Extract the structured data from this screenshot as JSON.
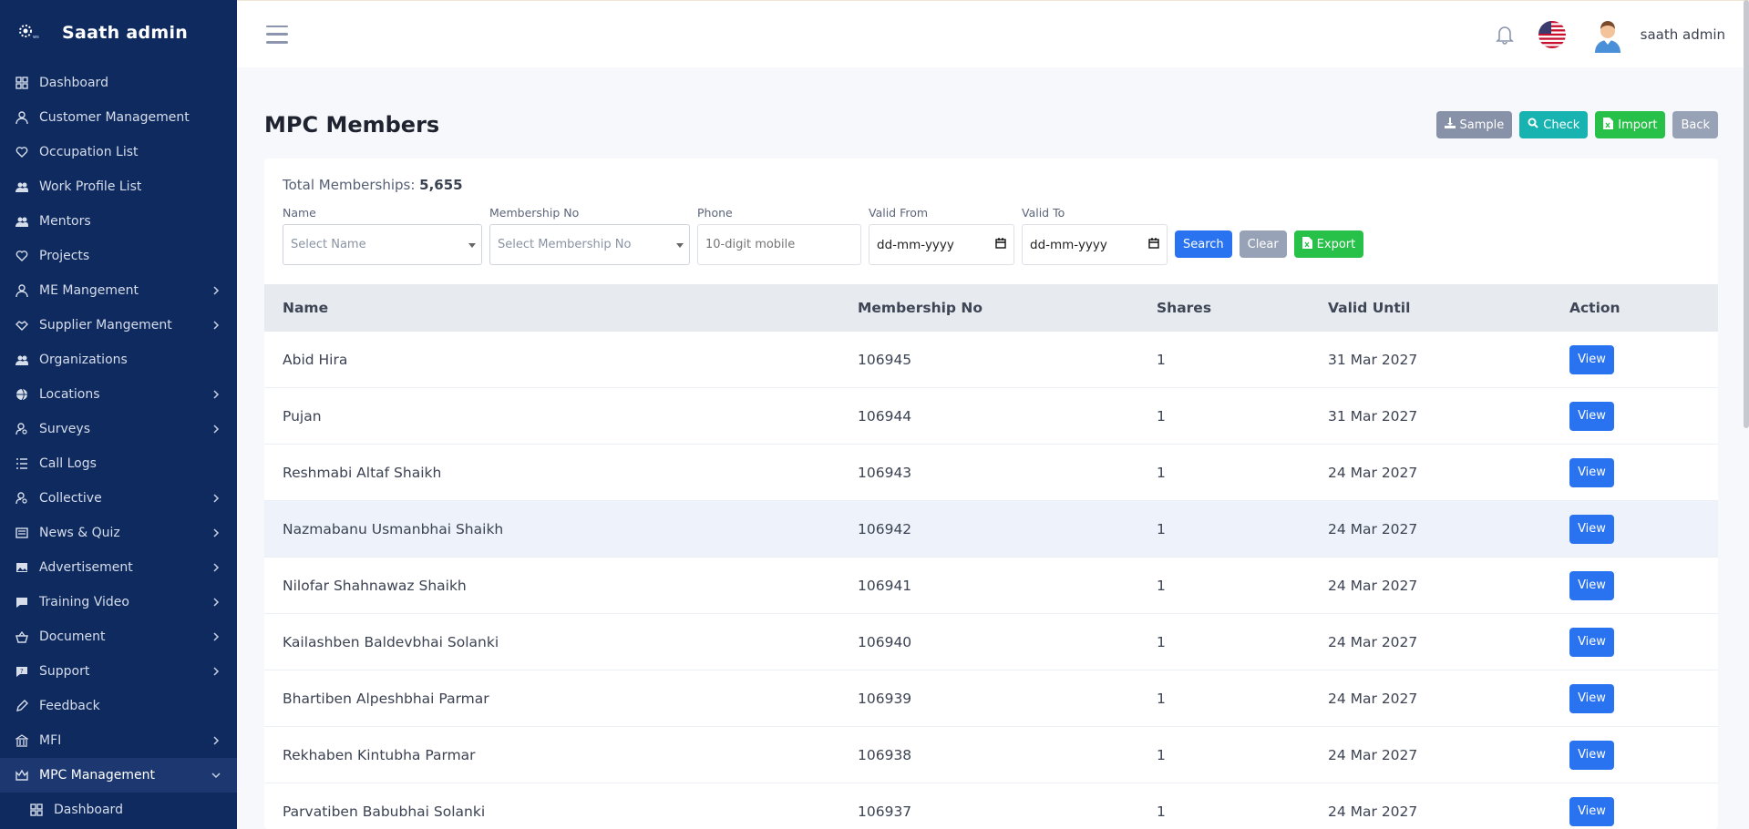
{
  "brand": {
    "title": "Saath admin"
  },
  "sidebar": {
    "items": [
      {
        "label": "Dashboard",
        "icon": "dashboard-icon",
        "chevron": false
      },
      {
        "label": "Customer Management",
        "icon": "user-icon",
        "chevron": false
      },
      {
        "label": "Occupation List",
        "icon": "heart-hand-icon",
        "chevron": false
      },
      {
        "label": "Work Profile List",
        "icon": "users-icon",
        "chevron": false
      },
      {
        "label": "Mentors",
        "icon": "users-icon",
        "chevron": false
      },
      {
        "label": "Projects",
        "icon": "heart-hand-icon",
        "chevron": false
      },
      {
        "label": "ME Mangement",
        "icon": "user-icon",
        "chevron": true
      },
      {
        "label": "Supplier Mangement",
        "icon": "handshake-icon",
        "chevron": true
      },
      {
        "label": "Organizations",
        "icon": "users-icon",
        "chevron": false
      },
      {
        "label": "Locations",
        "icon": "globe-icon",
        "chevron": true
      },
      {
        "label": "Surveys",
        "icon": "user-search-icon",
        "chevron": true
      },
      {
        "label": "Call Logs",
        "icon": "list-icon",
        "chevron": false
      },
      {
        "label": "Collective",
        "icon": "user-search-icon",
        "chevron": true
      },
      {
        "label": "News & Quiz",
        "icon": "newspaper-icon",
        "chevron": true
      },
      {
        "label": "Advertisement",
        "icon": "image-icon",
        "chevron": true
      },
      {
        "label": "Training Video",
        "icon": "chat-icon",
        "chevron": true
      },
      {
        "label": "Document",
        "icon": "basket-icon",
        "chevron": true
      },
      {
        "label": "Support",
        "icon": "support-icon",
        "chevron": true
      },
      {
        "label": "Feedback",
        "icon": "pen-icon",
        "chevron": false
      },
      {
        "label": "MFI",
        "icon": "bank-icon",
        "chevron": true
      },
      {
        "label": "MPC Management",
        "icon": "crown-icon",
        "chevron": true,
        "active": true,
        "expanded": true
      },
      {
        "label": "Dashboard",
        "icon": "dashboard-icon",
        "chevron": false,
        "sub": true
      }
    ]
  },
  "topbar": {
    "username": "saath admin"
  },
  "page": {
    "title": "MPC Members",
    "buttons": {
      "sample": "Sample",
      "check": "Check",
      "import": "Import",
      "back": "Back"
    }
  },
  "summary": {
    "label": "Total Memberships:",
    "value": "5,655"
  },
  "filters": {
    "name_label": "Name",
    "name_placeholder": "Select Name",
    "mno_label": "Membership No",
    "mno_placeholder": "Select Membership No",
    "phone_label": "Phone",
    "phone_placeholder": "10-digit mobile",
    "from_label": "Valid From",
    "from_value": "dd-mm-yyyy",
    "to_label": "Valid To",
    "to_value": "dd-mm-yyyy",
    "search": "Search",
    "clear": "Clear",
    "export": "Export"
  },
  "table": {
    "headers": {
      "name": "Name",
      "mno": "Membership No",
      "shares": "Shares",
      "valid": "Valid Until",
      "action": "Action"
    },
    "rows": [
      {
        "name": "Abid Hira",
        "mno": "106945",
        "shares": "1",
        "valid": "31 Mar 2027",
        "action": "View"
      },
      {
        "name": "Pujan",
        "mno": "106944",
        "shares": "1",
        "valid": "31 Mar 2027",
        "action": "View"
      },
      {
        "name": "Reshmabi Altaf Shaikh",
        "mno": "106943",
        "shares": "1",
        "valid": "24 Mar 2027",
        "action": "View"
      },
      {
        "name": "Nazmabanu Usmanbhai Shaikh",
        "mno": "106942",
        "shares": "1",
        "valid": "24 Mar 2027",
        "action": "View",
        "highlight": true
      },
      {
        "name": "Nilofar Shahnawaz Shaikh",
        "mno": "106941",
        "shares": "1",
        "valid": "24 Mar 2027",
        "action": "View"
      },
      {
        "name": "Kailashben Baldevbhai Solanki",
        "mno": "106940",
        "shares": "1",
        "valid": "24 Mar 2027",
        "action": "View"
      },
      {
        "name": "Bhartiben Alpeshbhai Parmar",
        "mno": "106939",
        "shares": "1",
        "valid": "24 Mar 2027",
        "action": "View"
      },
      {
        "name": "Rekhaben Kintubha Parmar",
        "mno": "106938",
        "shares": "1",
        "valid": "24 Mar 2027",
        "action": "View"
      },
      {
        "name": "Parvatiben Babubhai Solanki",
        "mno": "106937",
        "shares": "1",
        "valid": "24 Mar 2027",
        "action": "View"
      }
    ]
  },
  "colors": {
    "sidebar_bg": "#0f2a5f",
    "primary": "#2a73f0",
    "teal": "#16b3b1",
    "green": "#27c048",
    "grey": "#8792a8"
  }
}
